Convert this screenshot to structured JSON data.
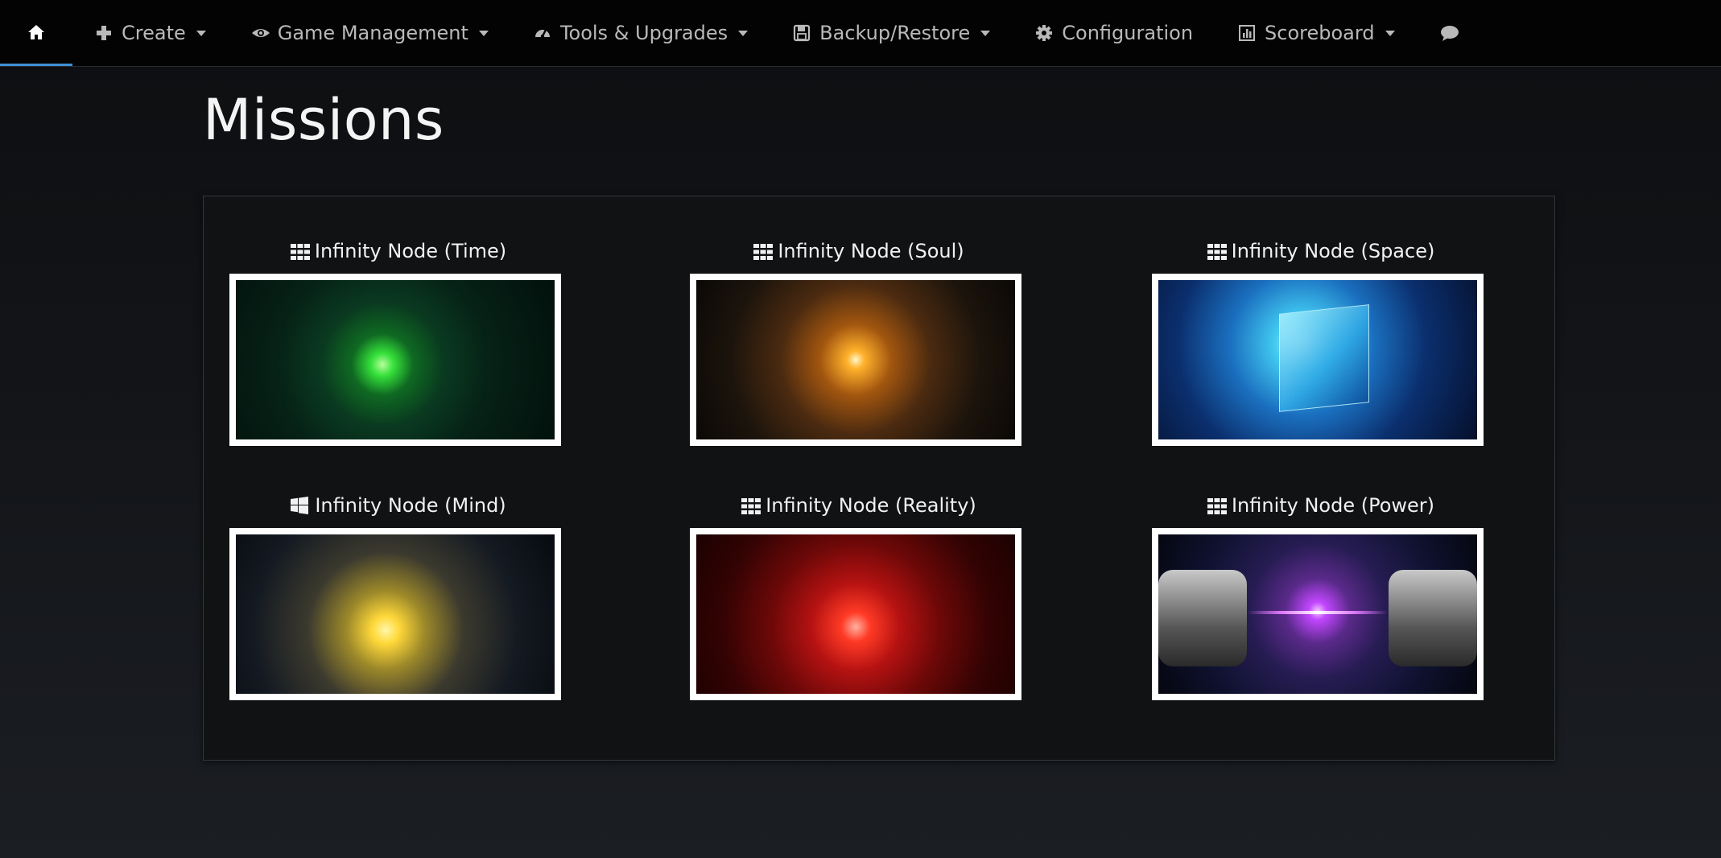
{
  "navbar": {
    "items": [
      {
        "label": "",
        "icon": "home-icon"
      },
      {
        "label": "Create",
        "icon": "plus-icon"
      },
      {
        "label": "Game Management",
        "icon": "eye-icon"
      },
      {
        "label": "Tools & Upgrades",
        "icon": "dashboard-icon"
      },
      {
        "label": "Backup/Restore",
        "icon": "save-icon"
      },
      {
        "label": "Configuration",
        "icon": "gear-icon"
      },
      {
        "label": "Scoreboard",
        "icon": "bar-chart-icon"
      },
      {
        "label": "",
        "icon": "chat-icon"
      }
    ]
  },
  "page": {
    "title": "Missions"
  },
  "missions": [
    {
      "label": "Infinity Node (Time)",
      "icon": "grid-icon"
    },
    {
      "label": "Infinity Node (Soul)",
      "icon": "grid-icon"
    },
    {
      "label": "Infinity Node (Space)",
      "icon": "grid-icon"
    },
    {
      "label": "Infinity Node (Mind)",
      "icon": "windows-icon"
    },
    {
      "label": "Infinity Node (Reality)",
      "icon": "grid-icon"
    },
    {
      "label": "Infinity Node (Power)",
      "icon": "grid-icon"
    }
  ],
  "colors": {
    "navbar_bg": "#030303",
    "active_underline": "#3f8fd6",
    "panel_bg": "#111214",
    "thumb_border": "#ffffff"
  }
}
